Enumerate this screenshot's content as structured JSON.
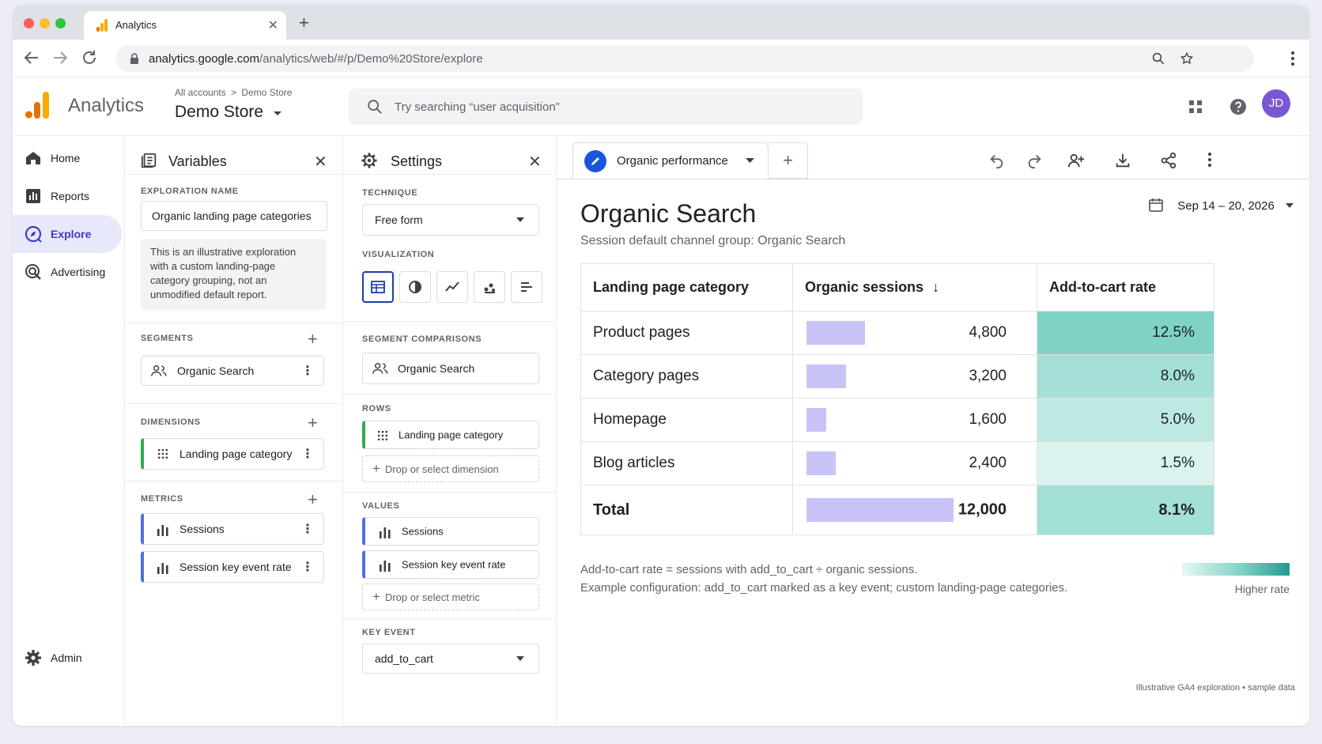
{
  "browser": {
    "tab_title": "Analytics",
    "url_host": "analytics.google.com",
    "url_path": "/analytics/web/#/p/Demo%20Store/explore"
  },
  "header": {
    "brand": "Analytics",
    "breadcrumb_all": "All accounts",
    "breadcrumb_sep": ">",
    "breadcrumb_current": "Demo Store",
    "property": "Demo Store",
    "search_placeholder": "Try searching “user acquisition”",
    "avatar_initials": "JD"
  },
  "nav": {
    "items": [
      {
        "label": "Home",
        "icon": "home-icon"
      },
      {
        "label": "Reports",
        "icon": "reports-icon"
      },
      {
        "label": "Explore",
        "icon": "explore-icon"
      },
      {
        "label": "Advertising",
        "icon": "advertising-icon"
      }
    ],
    "admin": "Admin"
  },
  "variables": {
    "title": "Variables",
    "exploration_name_label": "EXPLORATION NAME",
    "exploration_name": "Organic landing page categories",
    "note_lines": [
      "This is an illustrative exploration",
      "with a custom landing-page",
      "category grouping, not an",
      "unmodified default report."
    ],
    "segments_label": "SEGMENTS",
    "segments": [
      "Organic Search"
    ],
    "dimensions_label": "DIMENSIONS",
    "dimensions": [
      "Landing page category"
    ],
    "metrics_label": "METRICS",
    "metrics": [
      "Sessions",
      "Session key event rate"
    ]
  },
  "settings": {
    "title": "Settings",
    "technique_label": "TECHNIQUE",
    "technique": "Free form",
    "visualization_label": "VISUALIZATION",
    "segment_comparisons_label": "SEGMENT COMPARISONS",
    "segment_comparison": "Organic Search",
    "rows_label": "ROWS",
    "row": "Landing page category",
    "drop_dimension": "Drop or select dimension",
    "values_label": "VALUES",
    "values": [
      "Sessions",
      "Session key event rate"
    ],
    "drop_metric": "Drop or select metric",
    "key_event_label": "KEY EVENT",
    "key_event": "add_to_cart"
  },
  "canvas": {
    "tab_name": "Organic performance",
    "title": "Organic Search",
    "subtitle": "Session default channel group: Organic Search",
    "date_range": "Sep 14 – 20, 2026",
    "columns": [
      "Landing page category",
      "Organic sessions",
      "Add-to-cart rate"
    ],
    "sort_arrow": "↓",
    "rows": [
      {
        "category": "Product pages",
        "sessions": "4,800",
        "sessions_value": 4800,
        "rate": "12.5%",
        "rate_value": 12.5
      },
      {
        "category": "Category pages",
        "sessions": "3,200",
        "sessions_value": 3200,
        "rate": "8.0%",
        "rate_value": 8.0
      },
      {
        "category": "Homepage",
        "sessions": "1,600",
        "sessions_value": 1600,
        "rate": "5.0%",
        "rate_value": 5.0
      },
      {
        "category": "Blog articles",
        "sessions": "2,400",
        "sessions_value": 2400,
        "rate": "1.5%",
        "rate_value": 1.5
      }
    ],
    "total": {
      "category": "Total",
      "sessions": "12,000",
      "sessions_value": 12000,
      "rate": "8.1%",
      "rate_value": 8.1
    },
    "footnote_1": "Add-to-cart rate = sessions with add_to_cart ÷ organic sessions.",
    "footnote_2": "Example configuration: add_to_cart marked as a key event; custom landing-page categories.",
    "legend_label": "Higher rate"
  },
  "watermark": "Illustrative GA4 exploration • sample data",
  "colors": {
    "accent": "#3c3cc8",
    "bar": "#c9c4f7",
    "heat_high": "#7fd3c6",
    "heat_low": "#e6f7f4",
    "dimension_chip": "#34a853",
    "metric_chip": "#4f6fe0"
  }
}
